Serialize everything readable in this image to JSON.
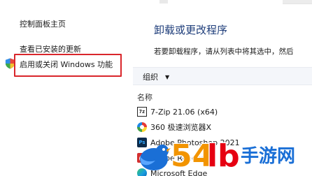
{
  "sidebar": {
    "home_link": "控制面板主页",
    "updates_link": "查看已安装的更新",
    "features_link": "启用或关闭 Windows 功能"
  },
  "main": {
    "title": "卸载或更改程序",
    "instructions": "若要卸载程序，请从列表中将其选中，然后"
  },
  "toolbar": {
    "organize_label": "组织",
    "organize_caret": "▼"
  },
  "list": {
    "column_name": "名称",
    "programs": [
      {
        "name": "7-Zip 21.06 (x64)",
        "icon": "7zip-icon",
        "icon_text": "7z"
      },
      {
        "name": "360 极速浏览器X",
        "icon": "360-browser-icon",
        "icon_text": ""
      },
      {
        "name": "Adobe Photoshop 2021",
        "icon": "photoshop-icon",
        "icon_text": "Ps"
      },
      {
        "name": "Adobe Reader",
        "icon": "adobe-reader-icon",
        "icon_text": ""
      },
      {
        "name": "Microsoft Edge",
        "icon": "edge-icon",
        "icon_text": ""
      }
    ]
  },
  "watermark": {
    "text": "54lb手游网",
    "colors": {
      "orange": "#f29400",
      "red": "#e60012",
      "blue": "#1a6fd6"
    }
  },
  "colors": {
    "highlight_border": "#d9262b",
    "title_blue": "#1e3d7a",
    "toolbar_bg": "#f4f6fa"
  }
}
